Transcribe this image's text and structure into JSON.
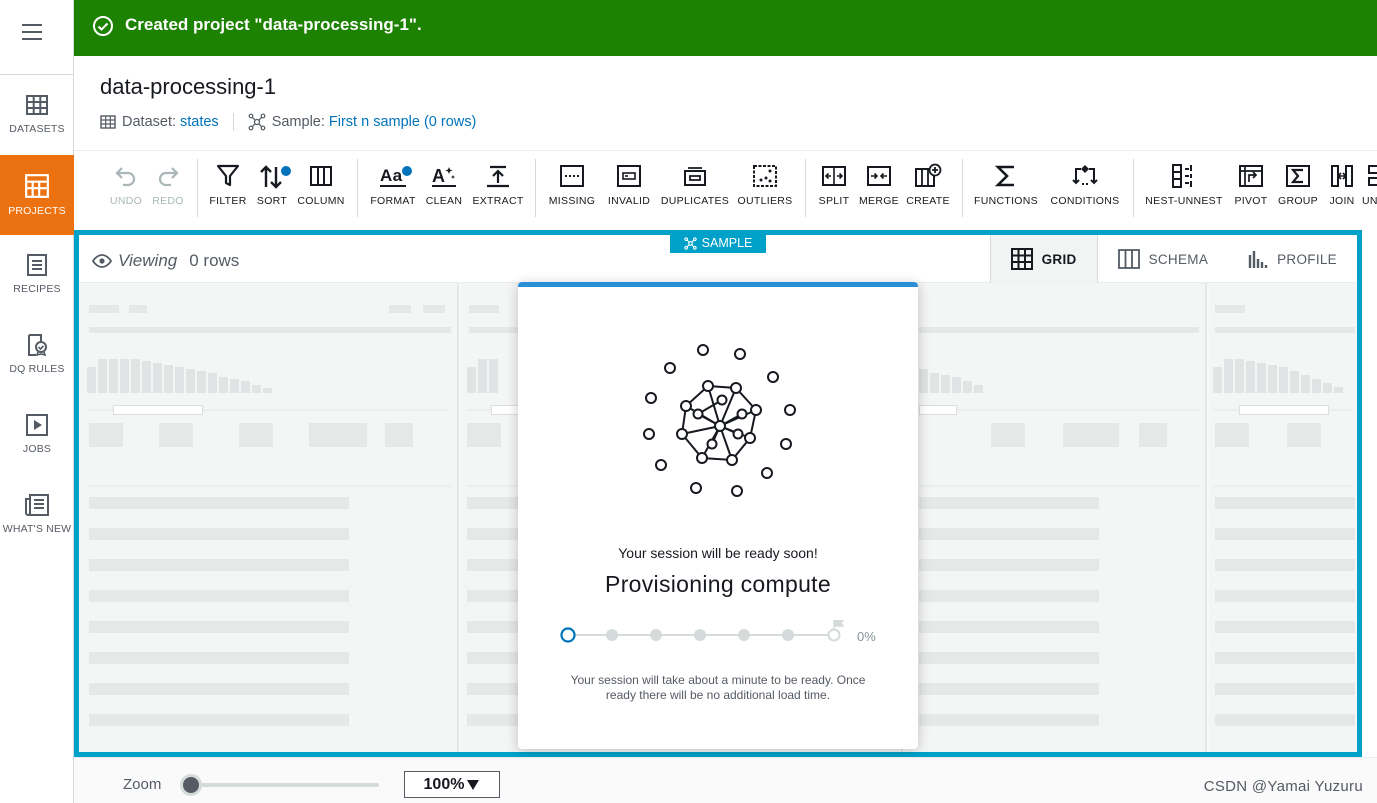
{
  "flash": {
    "message": "Created project \"data-processing-1\"."
  },
  "nav": {
    "items": [
      {
        "label": "DATASETS",
        "icon": "table-icon",
        "active": false
      },
      {
        "label": "PROJECTS",
        "icon": "projects-icon",
        "active": true
      },
      {
        "label": "RECIPES",
        "icon": "recipes-icon",
        "active": false
      },
      {
        "label": "DQ RULES",
        "icon": "dq-rules-icon",
        "active": false
      },
      {
        "label": "JOBS",
        "icon": "play-icon",
        "active": false
      },
      {
        "label": "WHAT'S NEW",
        "icon": "news-icon",
        "active": false
      }
    ]
  },
  "header": {
    "title": "data-processing-1",
    "dataset_label": "Dataset:",
    "dataset_value": "states",
    "sample_label": "Sample:",
    "sample_value": "First n sample (0 rows)"
  },
  "toolbar": {
    "undo": "UNDO",
    "redo": "REDO",
    "filter": "FILTER",
    "sort": "SORT",
    "column": "COLUMN",
    "format": "FORMAT",
    "clean": "CLEAN",
    "extract": "EXTRACT",
    "missing": "MISSING",
    "invalid": "INVALID",
    "duplicates": "DUPLICATES",
    "outliers": "OUTLIERS",
    "split": "SPLIT",
    "merge": "MERGE",
    "create": "CREATE",
    "functions": "FUNCTIONS",
    "conditions": "CONDITIONS",
    "nest_unnest": "NEST-UNNEST",
    "pivot": "PIVOT",
    "group": "GROUP",
    "join": "JOIN",
    "union": "UN"
  },
  "view": {
    "viewing_label": "Viewing",
    "row_count": "0 rows",
    "sample_badge": "SAMPLE",
    "tabs": [
      {
        "label": "GRID",
        "active": true
      },
      {
        "label": "SCHEMA",
        "active": false
      },
      {
        "label": "PROFILE",
        "active": false
      }
    ]
  },
  "modal": {
    "ready_text": "Your session will be ready soon!",
    "status": "Provisioning compute",
    "progress_percent_label": "0%",
    "progress_value": 0,
    "note": "Your session will take about a minute to be ready. Once ready there will be no additional load time."
  },
  "footer": {
    "zoom_label": "Zoom",
    "zoom_value": "100%",
    "watermark": "CSDN @Yamai Yuzuru"
  },
  "colors": {
    "flash_green": "#1d8102",
    "nav_active": "#ec7211",
    "link_blue": "#0073bb",
    "panel_border": "#00a1c9"
  }
}
